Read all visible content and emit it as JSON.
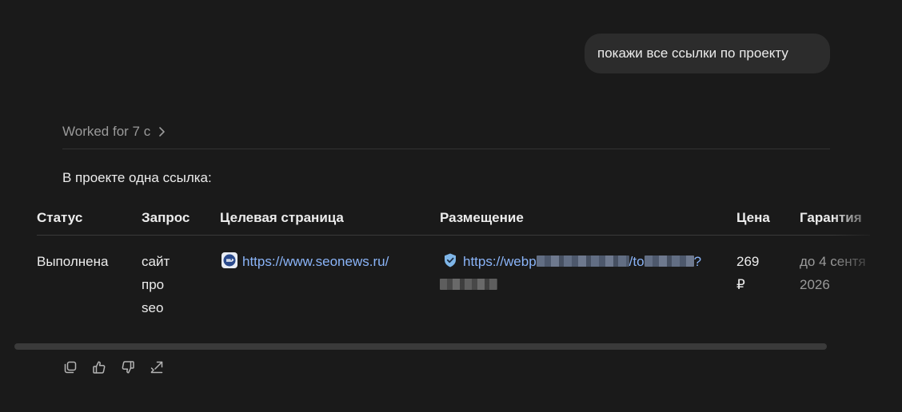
{
  "user_message": "покажи все ссылки по проекту",
  "worked_label": "Worked for 7 с",
  "answer_intro": "В проекте одна ссылка:",
  "table": {
    "headers": {
      "status": "Статус",
      "query": "Запрос",
      "target": "Целевая страница",
      "placement": "Размещение",
      "price": "Цена",
      "guarantee": "Гарантия"
    },
    "row": {
      "status": "Выполнена",
      "query_lines": [
        "сайт",
        "про",
        "seo"
      ],
      "target_url": "https://www.seonews.ru/",
      "placement_url_visible_start": "https://webp",
      "placement_url_visible_mid": "/to",
      "placement_url_visible_end": "?",
      "price_lines": [
        "269",
        "₽"
      ],
      "guarantee_lines": [
        "до 4 сентя",
        "2026"
      ]
    }
  },
  "icons": {
    "worked_chevron": "chevron-right-icon",
    "target_favicon": "seonews-favicon-icon",
    "placement_favicon": "shield-icon",
    "actions": [
      "copy-icon",
      "thumbs-up-icon",
      "thumbs-down-icon",
      "share-icon"
    ]
  },
  "colors": {
    "background": "#1a1a1a",
    "bubble": "#2c2c2c",
    "link": "#8ab4f8",
    "muted": "#9a9a9a"
  }
}
